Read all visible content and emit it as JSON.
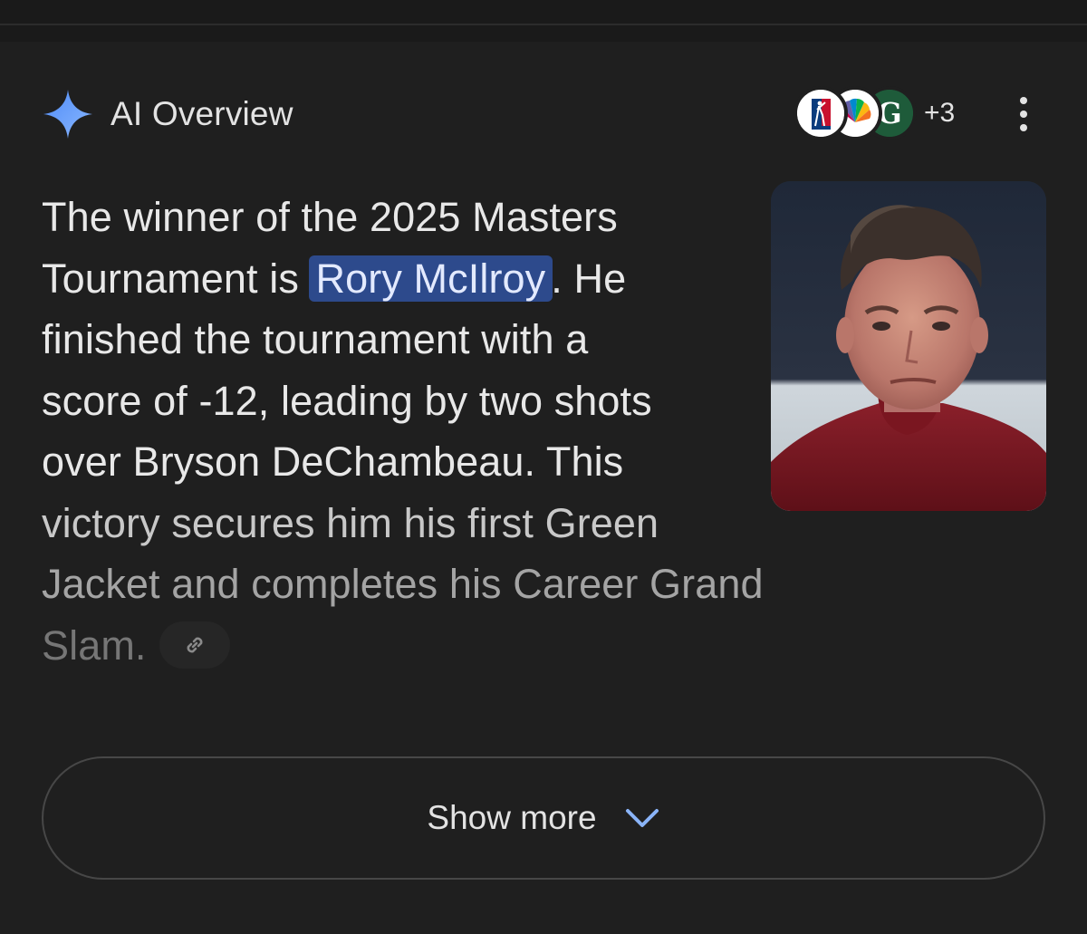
{
  "overview": {
    "title": "AI Overview",
    "source_count": "+3",
    "sources": [
      {
        "icon": "pga-tour-logo-icon"
      },
      {
        "icon": "nbc-peacock-logo-icon"
      },
      {
        "icon": "golf-digest-logo-icon"
      }
    ],
    "menu_icon": "more-vert-icon",
    "answer": {
      "line1": "The winner of the 2025 Masters",
      "line2_pre": "Tournament is ",
      "line2_highlight": "Rory McIlroy",
      "line2_post": ". He",
      "line3": "finished the tournament with a",
      "line4": "score of -12, leading by two shots",
      "line5": "over Bryson DeChambeau. This",
      "line6": "victory secures him his first Green",
      "line7": "Jacket and completes his Career Grand",
      "line8": "Slam."
    },
    "link_icon": "link-icon",
    "thumbnail_icon": "rory-mcilroy-photo",
    "show_more_label": "Show more",
    "show_more_icon": "chevron-down-icon"
  },
  "colors": {
    "background": "#1f1f1f",
    "highlight": "#2d4a8c",
    "sparkle": "#7fb0ff",
    "text": "#e8e8e8"
  }
}
